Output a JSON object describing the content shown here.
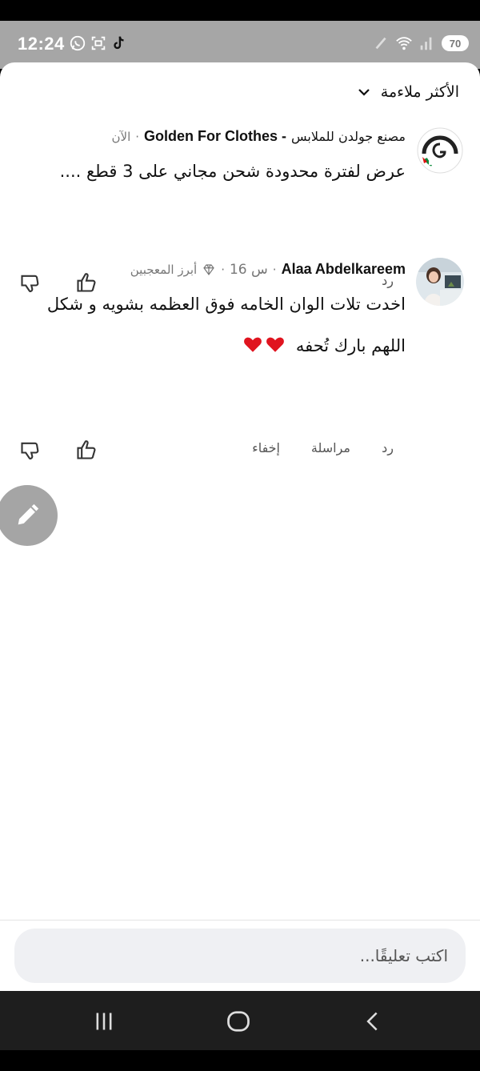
{
  "status": {
    "time": "12:24",
    "battery": "70"
  },
  "sort": {
    "label": "الأكثر ملاءمة"
  },
  "comments": [
    {
      "author": "Golden For Clothes -",
      "author_ar": "مصنع جولدن للملابس",
      "time": "الآن",
      "text": "عرض لفترة محدودة شحن مجاني على 3 قطع ....",
      "actions": {
        "reply": "رد"
      }
    },
    {
      "author": "Alaa Abdelkareem",
      "time": "16 س",
      "badge": "أبرز المعجبين",
      "text_line1": "اخدت تلات الوان الخامه فوق العظمه بشويه و شكل",
      "text_line2": "اللهم بارك تُحفه ♥️♥️",
      "actions": {
        "reply": "رد",
        "message": "مراسلة",
        "hide": "إخفاء"
      }
    }
  ],
  "composer": {
    "placeholder": "اكتب تعليقًا..."
  },
  "colors": {
    "heart": "#e0141f",
    "fab": "#a5a5a5",
    "navbar": "#1e1e1e"
  }
}
